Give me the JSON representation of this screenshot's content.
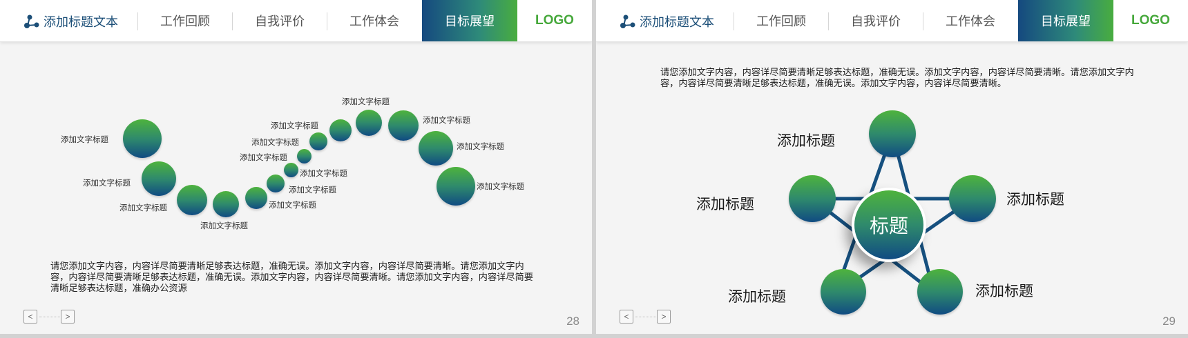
{
  "nav": {
    "brand": "添加标题文本",
    "tabs": [
      "工作回顾",
      "自我评价",
      "工作体会",
      "目标展望"
    ],
    "active_tab": 3,
    "logo": "LOGO"
  },
  "colors": {
    "accent_blue": "#15497f",
    "accent_green": "#49ad3f"
  },
  "slide28": {
    "page_number": "28",
    "labels": [
      "添加文字标题",
      "添加文字标题",
      "添加文字标题",
      "添加文字标题",
      "添加文字标题",
      "添加文字标题",
      "添加文字标题",
      "添加文字标题",
      "添加文字标题",
      "添加文字标题",
      "添加文字标题",
      "添加文字标题",
      "添加文字标题",
      "添加文字标题"
    ],
    "paragraph": "请您添加文字内容，内容详尽简要清晰足够表达标题，准确无误。添加文字内容，内容详尽简要清晰。请您添加文字内容，内容详尽简要清晰足够表达标题，准确无误。添加文字内容，内容详尽简要清晰。请您添加文字内容，内容详尽简要清晰足够表达标题，准确办公资源",
    "pager": {
      "prev": "<",
      "next": ">"
    }
  },
  "slide29": {
    "page_number": "29",
    "paragraph": "请您添加文字内容，内容详尽简要清晰足够表达标题，准确无误。添加文字内容，内容详尽简要清晰。请您添加文字内容，内容详尽简要清晰足够表达标题，准确无误。添加文字内容，内容详尽简要清晰。",
    "center": "标题",
    "labels": [
      "添加标题",
      "添加标题",
      "添加标题",
      "添加标题",
      "添加标题"
    ],
    "pager": {
      "prev": "<",
      "next": ">"
    }
  }
}
